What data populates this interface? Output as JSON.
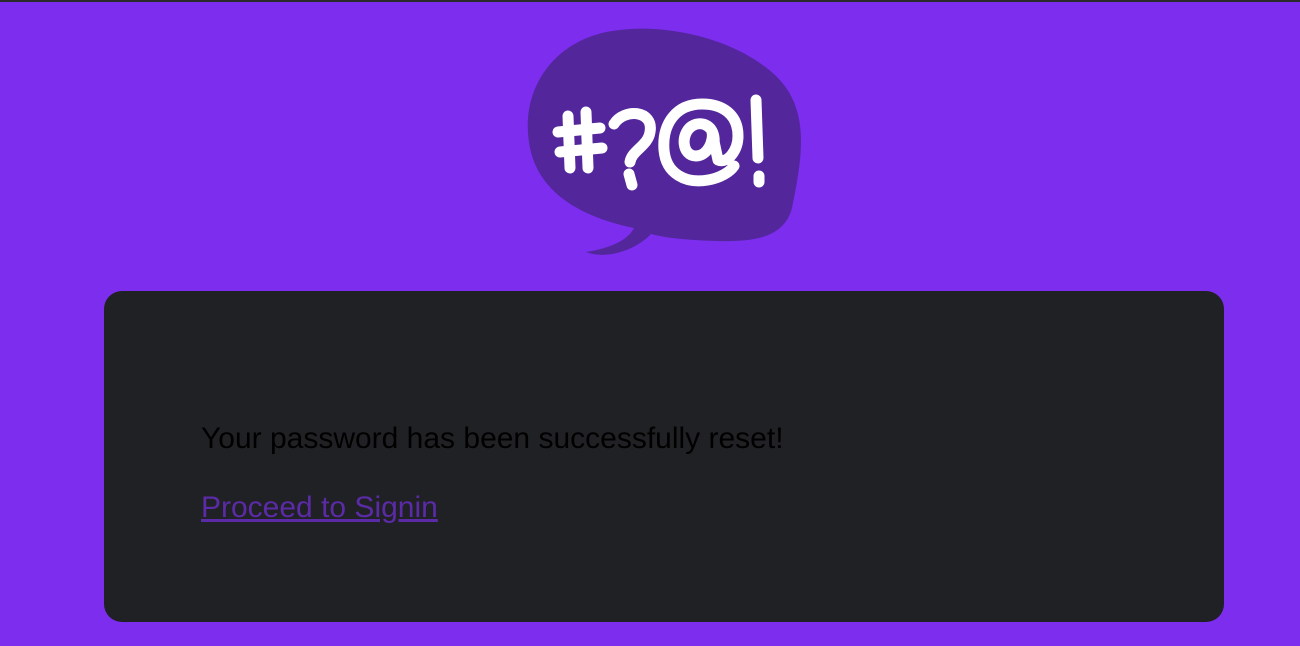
{
  "colors": {
    "page_background": "#7c2ded",
    "logo_bubble": "#53269c",
    "logo_glyphs": "#ffffff",
    "card_background": "#202124",
    "message_text": "#000000",
    "link_text": "#5b2aa6"
  },
  "logo": {
    "icon": "speech-bubble-symbols-icon",
    "symbols": "#?@!"
  },
  "card": {
    "message": "Your password has been successfully reset!",
    "signin_link": "Proceed to Signin"
  }
}
